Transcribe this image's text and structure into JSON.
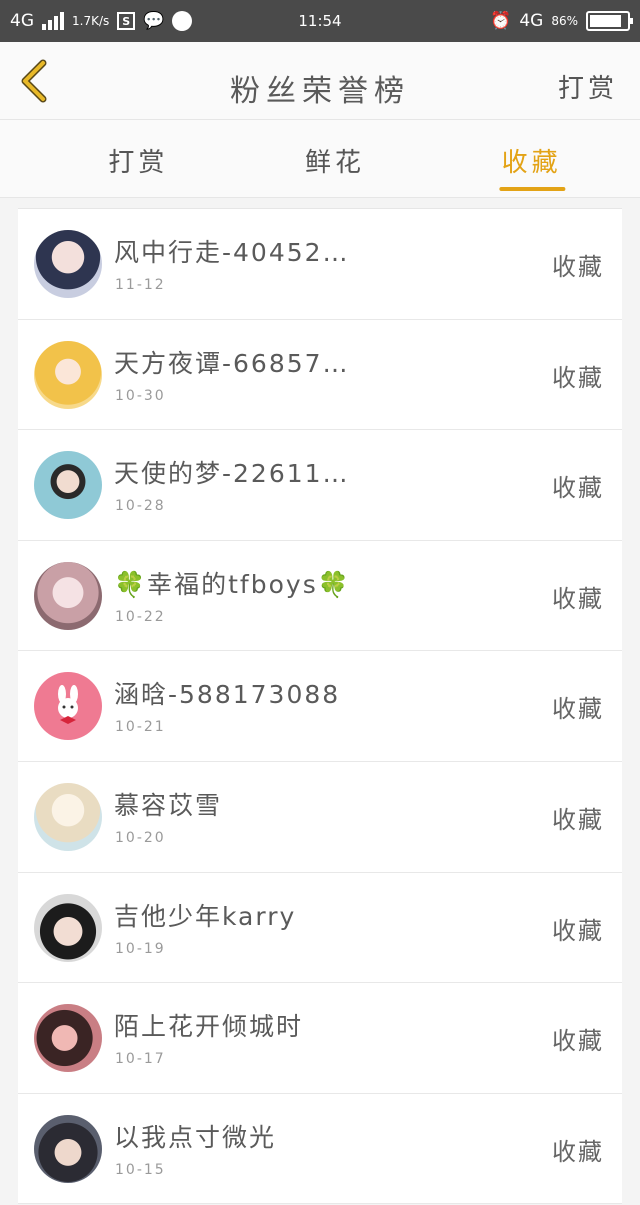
{
  "status_bar": {
    "network": "4G",
    "speed": "1.7K/s",
    "time": "11:54",
    "network_right": "4G",
    "battery": "86%",
    "battery_level": 0.86
  },
  "header": {
    "title": "粉丝荣誉榜",
    "action": "打赏"
  },
  "tabs": [
    {
      "label": "打赏",
      "active": false
    },
    {
      "label": "鲜花",
      "active": false
    },
    {
      "label": "收藏",
      "active": true
    }
  ],
  "colors": {
    "accent": "#e3a316",
    "status_bar": "#4a4a4a"
  },
  "fans": [
    {
      "name": "风中行走-40452…",
      "date": "11-12",
      "action": "收藏",
      "avatar_icon": "girl-portrait"
    },
    {
      "name": "天方夜谭-66857…",
      "date": "10-30",
      "action": "收藏",
      "avatar_icon": "blonde-anime-girl"
    },
    {
      "name": "天使的梦-22611…",
      "date": "10-28",
      "action": "收藏",
      "avatar_icon": "girl-sunglasses"
    },
    {
      "name": "🍀幸福的tfboys🍀",
      "date": "10-22",
      "action": "收藏",
      "avatar_icon": "child-photo"
    },
    {
      "name": "涵晗-588173088",
      "date": "10-21",
      "action": "收藏",
      "avatar_icon": "bunny-pink"
    },
    {
      "name": "慕容苡雪",
      "date": "10-20",
      "action": "收藏",
      "avatar_icon": "princess-drawing"
    },
    {
      "name": "吉他少年karry",
      "date": "10-19",
      "action": "收藏",
      "avatar_icon": "boy-portrait"
    },
    {
      "name": "陌上花开倾城时",
      "date": "10-17",
      "action": "收藏",
      "avatar_icon": "girl-dark"
    },
    {
      "name": "以我点寸微光",
      "date": "10-15",
      "action": "收藏",
      "avatar_icon": "cat-ears-boy"
    }
  ]
}
